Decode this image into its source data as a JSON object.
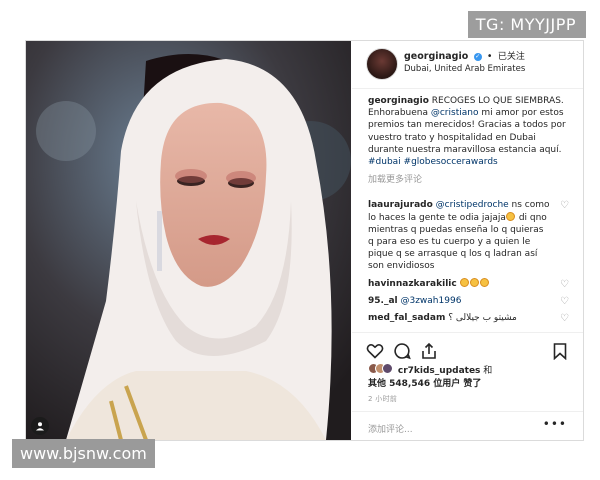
{
  "watermarks": {
    "top_right": "TG: MYYJJPP",
    "bottom_left": "www.bjsnw.com"
  },
  "post": {
    "photo": {
      "alt": "",
      "user_tag_icon": "person-icon"
    },
    "header": {
      "username": "georginagio",
      "separator": "•",
      "follow_label": "已关注",
      "location": "Dubai, United Arab Emirates"
    },
    "caption": {
      "username": "georginagio",
      "text_1": " RECOGES LO QUE SIEMBRAS. Enhorabuena ",
      "mention": "@cristiano",
      "text_2": " mi amor por estos premios tan merecidos! Gracias a todos por vuestro trato y hospitalidad en Dubai durante nuestra maravillosa estancia aquí. ",
      "hashtags": "#dubai #globesoccerawards"
    },
    "load_more": "加载更多评论",
    "comments": [
      {
        "user": "laaurajurado",
        "mention": "@cristipedroche",
        "text": " ns como lo haces la gente te odia jajaja",
        "text_after_emoji": " di qno mientras q puedas enseña lo q quieras q para eso es tu cuerpo y a quien le pique q se arrasque q los q ladran así son envidiosos"
      },
      {
        "user": "havinnazkarakilic",
        "mention": "",
        "text": " "
      },
      {
        "user": "95._al",
        "mention": "@3zwah1996",
        "text": ""
      },
      {
        "user": "med_fal_sadam",
        "mention": "",
        "text": " مشيتو ب جيلالى ؟"
      }
    ],
    "likes": {
      "first_user": "cr7kids_updates",
      "and": " 和",
      "others_prefix": "其他 ",
      "count": "548,546",
      "others_suffix": " 位用户 赞了"
    },
    "time": "2 小时前",
    "add_comment_placeholder": "添加评论...",
    "more_label": "•••"
  },
  "colors": {
    "mention": "#003569",
    "verified": "#3897f0",
    "muted": "#999999"
  }
}
